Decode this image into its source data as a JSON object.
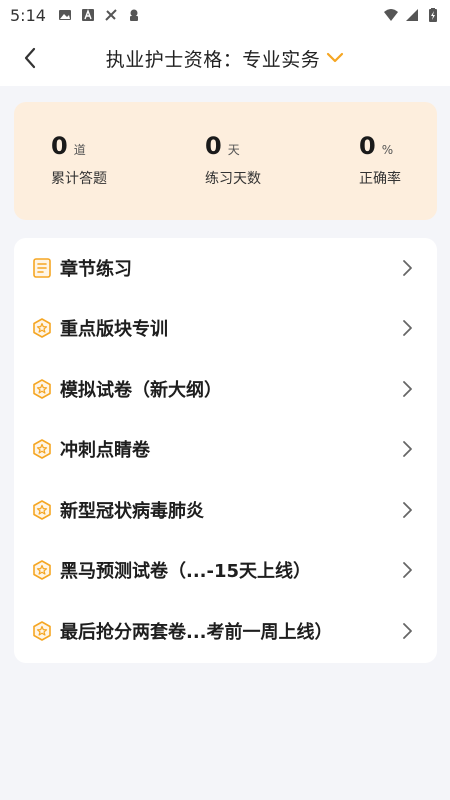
{
  "status_bar": {
    "time": "5:14"
  },
  "header": {
    "title": "执业护士资格：专业实务"
  },
  "stats": [
    {
      "value": "0",
      "unit": "道",
      "label": "累计答题"
    },
    {
      "value": "0",
      "unit": "天",
      "label": "练习天数"
    },
    {
      "value": "0",
      "unit": "%",
      "label": "正确率"
    }
  ],
  "menu": [
    {
      "label": "章节练习",
      "icon": "document-icon"
    },
    {
      "label": "重点版块专训",
      "icon": "badge-star-icon"
    },
    {
      "label": "模拟试卷（新大纲）",
      "icon": "badge-star-icon"
    },
    {
      "label": "冲刺点睛卷",
      "icon": "badge-star-icon"
    },
    {
      "label": "新型冠状病毒肺炎",
      "icon": "badge-star-icon"
    },
    {
      "label": "黑马预测试卷（...-15天上线）",
      "icon": "badge-star-icon"
    },
    {
      "label": "最后抢分两套卷...考前一周上线）",
      "icon": "badge-star-icon"
    }
  ],
  "colors": {
    "accent": "#f5a623",
    "stats_bg": "#fdeedd",
    "page_bg": "#f4f5f9"
  }
}
